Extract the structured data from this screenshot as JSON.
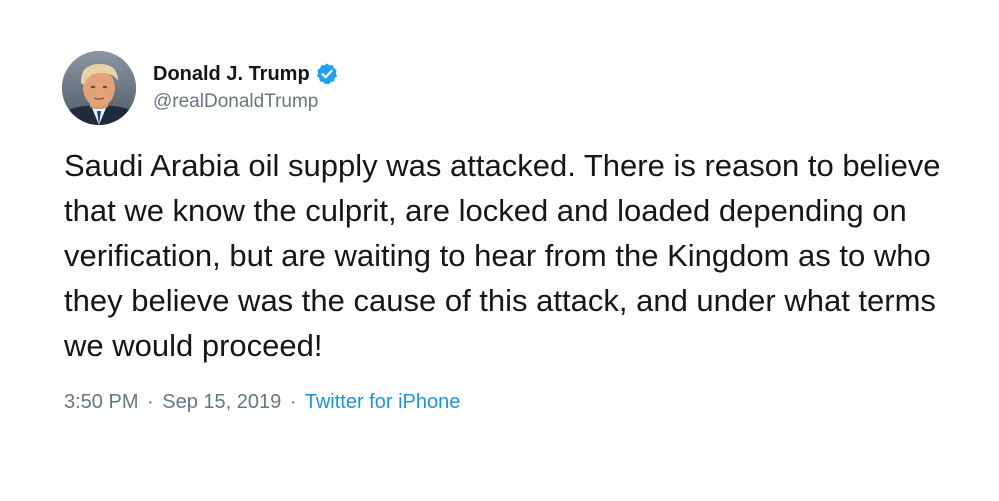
{
  "author": {
    "display_name": "Donald J. Trump",
    "handle": "@realDonaldTrump",
    "verified": true,
    "verified_color": "#1da1f2"
  },
  "tweet": {
    "text": "Saudi Arabia oil supply was attacked. There is reason to believe that we know the culprit, are locked and loaded depending on verification, but are waiting to hear from the Kingdom as to who they believe was the cause of this attack, and under what terms we would proceed!",
    "time": "3:50 PM",
    "separator": "·",
    "date": "Sep 15, 2019",
    "source": "Twitter for iPhone"
  },
  "colors": {
    "text": "#14171a",
    "muted": "#657786",
    "link": "#1b95e0"
  }
}
